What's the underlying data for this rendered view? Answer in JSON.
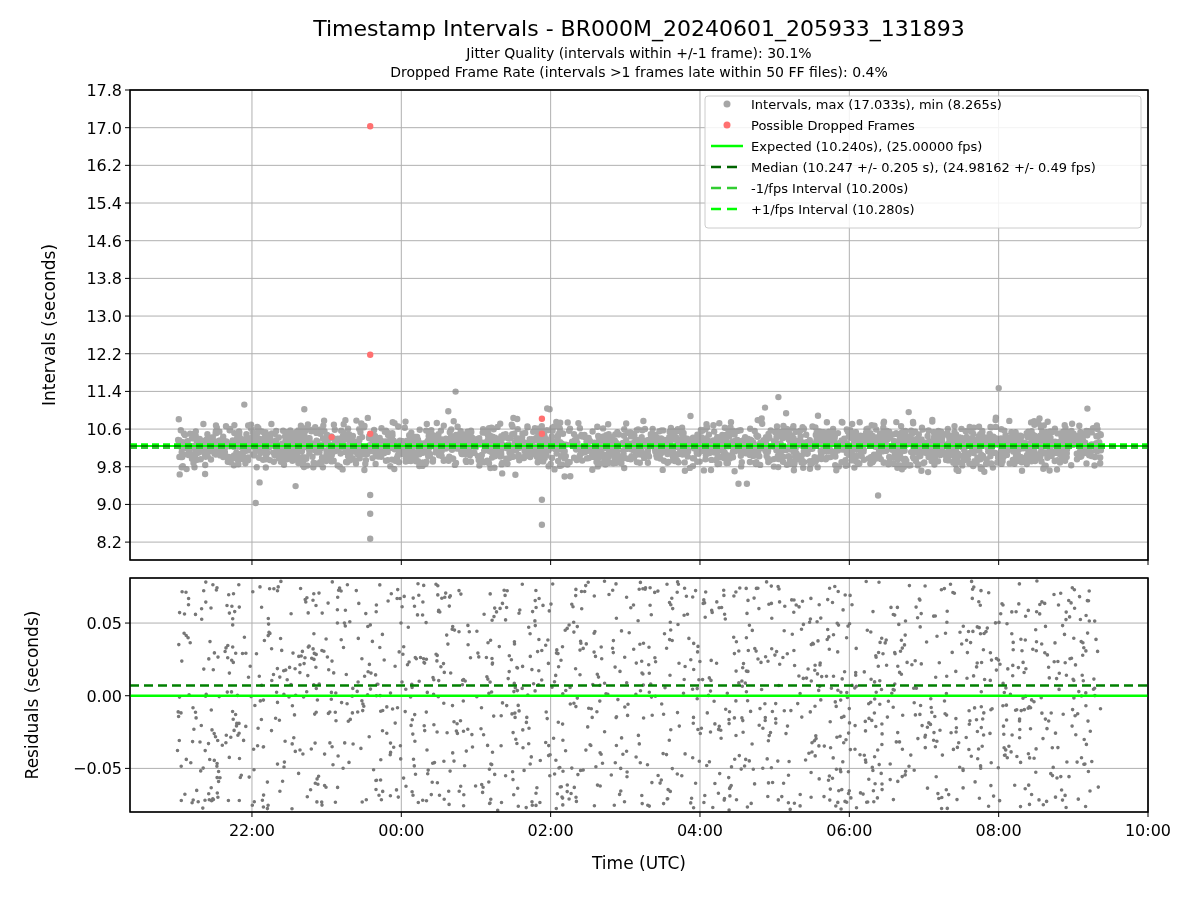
{
  "figure": {
    "title": "Timestamp Intervals - BR000M_20240601_205933_131893",
    "subtitle_lines": [
      "Jitter Quality (intervals within +/-1 frame): 30.1%",
      "Dropped Frame Rate (intervals >1 frames late within 50 FF files): 0.4%"
    ]
  },
  "intervals_panel": {
    "chart_data": {
      "type": "scatter",
      "ylabel": "Intervals (seconds)",
      "xlim": [
        "2024-06-01T20:22",
        "2024-06-02T10:00"
      ],
      "ylim": [
        7.82,
        17.8
      ],
      "grid": true,
      "legend": "upper right",
      "yticks": [
        {
          "value": 8.2,
          "label": "8.2"
        },
        {
          "value": 9.0,
          "label": "9.0"
        },
        {
          "value": 9.8,
          "label": "9.8"
        },
        {
          "value": 10.6,
          "label": "10.6"
        },
        {
          "value": 11.4,
          "label": "11.4"
        },
        {
          "value": 12.2,
          "label": "12.2"
        },
        {
          "value": 13.0,
          "label": "13.0"
        },
        {
          "value": 13.8,
          "label": "13.8"
        },
        {
          "value": 14.6,
          "label": "14.6"
        },
        {
          "value": 15.4,
          "label": "15.4"
        },
        {
          "value": 16.2,
          "label": "16.2"
        },
        {
          "value": 17.0,
          "label": "17.0"
        },
        {
          "value": 17.8,
          "label": "17.8"
        }
      ],
      "series": [
        {
          "name": "Intervals, max (17.033s), min (8.265s)",
          "color": "#a6a6a6",
          "x": [
            "2024-06-02T08:00",
            "2024-06-01T23:35",
            "2024-06-01T23:35",
            "2024-06-02T01:53",
            "2024-06-01T22:03",
            "2024-06-02T05:03",
            "2024-06-01T23:35",
            "2024-06-02T01:53"
          ],
          "values": [
            11.47,
            8.27,
            8.8,
            8.57,
            9.03,
            11.28,
            9.2,
            9.1
          ]
        },
        {
          "name": "Possible Dropped Frames",
          "color": "#ff7070",
          "x": [
            "2024-06-01T23:35",
            "2024-06-01T23:35",
            "2024-06-01T23:35",
            "2024-06-01T23:04",
            "2024-06-02T01:53",
            "2024-06-02T01:53"
          ],
          "values": [
            17.03,
            12.18,
            10.5,
            10.43,
            10.82,
            10.5
          ]
        }
      ],
      "ref_lines": [
        {
          "axis": "y",
          "value": 10.24,
          "label": "Expected (10.240s), (25.00000 fps)",
          "color": "#00ff00"
        },
        {
          "axis": "y",
          "value": 10.247,
          "label": "Median (10.247 +/- 0.205 s), (24.98162 +/- 0.49 fps)",
          "color": "#006400"
        },
        {
          "axis": "y",
          "value": 10.2,
          "label": "-1/fps Interval (10.200s)",
          "color": "#32cd32"
        },
        {
          "axis": "y",
          "value": 10.28,
          "label": "+1/fps Interval (10.280s)",
          "color": "#00ff00"
        }
      ]
    }
  },
  "residuals_panel": {
    "chart_data": {
      "type": "scatter",
      "xlabel": "Time (UTC)",
      "ylabel": "Residuals (seconds)",
      "xlim": [
        "2024-06-01T20:22",
        "2024-06-02T10:00"
      ],
      "ylim": [
        -0.08,
        0.081
      ],
      "grid": true,
      "xticks": [
        {
          "value": "2024-06-01T22:00",
          "label": "22:00"
        },
        {
          "value": "2024-06-02T00:00",
          "label": "00:00"
        },
        {
          "value": "2024-06-02T02:00",
          "label": "02:00"
        },
        {
          "value": "2024-06-02T04:00",
          "label": "04:00"
        },
        {
          "value": "2024-06-02T06:00",
          "label": "06:00"
        },
        {
          "value": "2024-06-02T08:00",
          "label": "08:00"
        },
        {
          "value": "2024-06-02T10:00",
          "label": "10:00"
        }
      ],
      "yticks": [
        {
          "value": -0.05,
          "label": "−0.05"
        },
        {
          "value": 0,
          "label": "0.00"
        },
        {
          "value": 0.05,
          "label": "0.05"
        }
      ],
      "ref_lines": [
        {
          "axis": "y",
          "value": 0,
          "color": "#00ff00"
        },
        {
          "axis": "y",
          "value": 0.007,
          "color": "#008000"
        }
      ]
    }
  }
}
